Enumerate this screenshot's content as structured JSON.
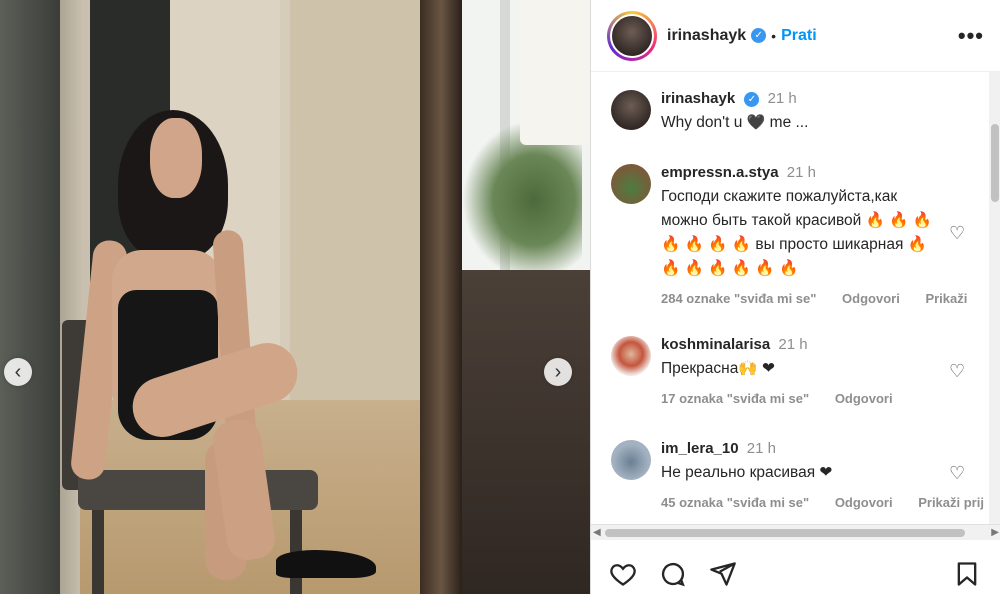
{
  "post": {
    "username": "irinashayk",
    "follow_label": "Prati",
    "more_label": "•••",
    "caption": {
      "username": "irinashayk",
      "time": "21 h",
      "text_before": "Why don't u ",
      "text_after": " me ..."
    }
  },
  "comments": [
    {
      "username": "empressn.a.stya",
      "time": "21 h",
      "text": "Господи скажите пожалуйста,как можно быть такой красивой 🔥 🔥 🔥 🔥 🔥 🔥 🔥 вы просто шикарная 🔥 🔥 🔥 🔥 🔥 🔥 🔥",
      "likes": "284 oznake \"sviđa mi se\"",
      "reply": "Odgovori",
      "show_replies": "Prikaži"
    },
    {
      "username": "koshminalarisa",
      "time": "21 h",
      "text": "Прекрасна🙌 ❤",
      "likes": "17 oznaka \"sviđa mi se\"",
      "reply": "Odgovori"
    },
    {
      "username": "im_lera_10",
      "time": "21 h",
      "text": "Не реально красивая ❤",
      "likes": "45 oznaka \"sviđa mi se\"",
      "reply": "Odgovori",
      "show_replies": "Prikaži prij"
    }
  ],
  "icons": {
    "like": "heart-icon",
    "comment": "comment-icon",
    "share": "share-icon",
    "save": "bookmark-icon",
    "prev": "chevron-left-icon",
    "next": "chevron-right-icon"
  },
  "colors": {
    "link": "#0095f6",
    "verified": "#3897f0",
    "red_heart": "#ed4956"
  }
}
